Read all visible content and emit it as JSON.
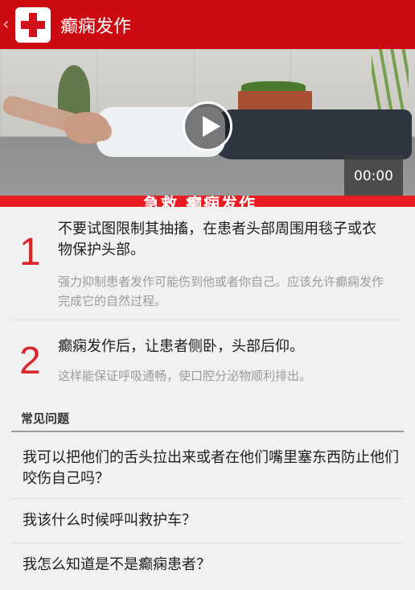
{
  "header": {
    "back_glyph": "‹",
    "logo_icon": "red-cross-icon",
    "title": "癫痫发作"
  },
  "video": {
    "time": "00:00",
    "caption": "急救 癫痫发作",
    "play_icon": "play-icon"
  },
  "steps": [
    {
      "number": "1",
      "main": "不要试图限制其抽搐，在患者头部周围用毯子或衣物保护头部。",
      "sub": "强力抑制患者发作可能伤到他或者你自己。应该允许癫痫发作完成它的自然过程。"
    },
    {
      "number": "2",
      "main": "癫痫发作后，让患者侧卧，头部后仰。",
      "sub": "这样能保证呼吸通畅，使口腔分泌物顺利排出。"
    }
  ],
  "faq": {
    "title": "常见问题",
    "items": [
      "我可以把他们的舌头拉出来或者在他们嘴里塞东西防止他们咬伤自己吗？",
      "我该什么时候呼叫救护车？",
      "我怎么知道是不是癫痫患者？"
    ]
  },
  "colors": {
    "accent": "#cc0a12",
    "step_number": "#d8262c"
  }
}
